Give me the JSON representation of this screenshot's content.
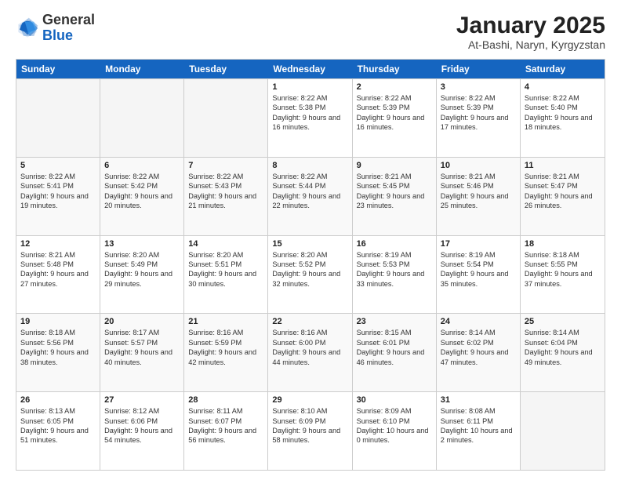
{
  "logo": {
    "general": "General",
    "blue": "Blue"
  },
  "title": "January 2025",
  "subtitle": "At-Bashi, Naryn, Kyrgyzstan",
  "days": [
    "Sunday",
    "Monday",
    "Tuesday",
    "Wednesday",
    "Thursday",
    "Friday",
    "Saturday"
  ],
  "weeks": [
    [
      {
        "day": "",
        "sunrise": "",
        "sunset": "",
        "daylight": "",
        "empty": true
      },
      {
        "day": "",
        "sunrise": "",
        "sunset": "",
        "daylight": "",
        "empty": true
      },
      {
        "day": "",
        "sunrise": "",
        "sunset": "",
        "daylight": "",
        "empty": true
      },
      {
        "day": "1",
        "sunrise": "Sunrise: 8:22 AM",
        "sunset": "Sunset: 5:38 PM",
        "daylight": "Daylight: 9 hours and 16 minutes."
      },
      {
        "day": "2",
        "sunrise": "Sunrise: 8:22 AM",
        "sunset": "Sunset: 5:39 PM",
        "daylight": "Daylight: 9 hours and 16 minutes."
      },
      {
        "day": "3",
        "sunrise": "Sunrise: 8:22 AM",
        "sunset": "Sunset: 5:39 PM",
        "daylight": "Daylight: 9 hours and 17 minutes."
      },
      {
        "day": "4",
        "sunrise": "Sunrise: 8:22 AM",
        "sunset": "Sunset: 5:40 PM",
        "daylight": "Daylight: 9 hours and 18 minutes."
      }
    ],
    [
      {
        "day": "5",
        "sunrise": "Sunrise: 8:22 AM",
        "sunset": "Sunset: 5:41 PM",
        "daylight": "Daylight: 9 hours and 19 minutes."
      },
      {
        "day": "6",
        "sunrise": "Sunrise: 8:22 AM",
        "sunset": "Sunset: 5:42 PM",
        "daylight": "Daylight: 9 hours and 20 minutes."
      },
      {
        "day": "7",
        "sunrise": "Sunrise: 8:22 AM",
        "sunset": "Sunset: 5:43 PM",
        "daylight": "Daylight: 9 hours and 21 minutes."
      },
      {
        "day": "8",
        "sunrise": "Sunrise: 8:22 AM",
        "sunset": "Sunset: 5:44 PM",
        "daylight": "Daylight: 9 hours and 22 minutes."
      },
      {
        "day": "9",
        "sunrise": "Sunrise: 8:21 AM",
        "sunset": "Sunset: 5:45 PM",
        "daylight": "Daylight: 9 hours and 23 minutes."
      },
      {
        "day": "10",
        "sunrise": "Sunrise: 8:21 AM",
        "sunset": "Sunset: 5:46 PM",
        "daylight": "Daylight: 9 hours and 25 minutes."
      },
      {
        "day": "11",
        "sunrise": "Sunrise: 8:21 AM",
        "sunset": "Sunset: 5:47 PM",
        "daylight": "Daylight: 9 hours and 26 minutes."
      }
    ],
    [
      {
        "day": "12",
        "sunrise": "Sunrise: 8:21 AM",
        "sunset": "Sunset: 5:48 PM",
        "daylight": "Daylight: 9 hours and 27 minutes."
      },
      {
        "day": "13",
        "sunrise": "Sunrise: 8:20 AM",
        "sunset": "Sunset: 5:49 PM",
        "daylight": "Daylight: 9 hours and 29 minutes."
      },
      {
        "day": "14",
        "sunrise": "Sunrise: 8:20 AM",
        "sunset": "Sunset: 5:51 PM",
        "daylight": "Daylight: 9 hours and 30 minutes."
      },
      {
        "day": "15",
        "sunrise": "Sunrise: 8:20 AM",
        "sunset": "Sunset: 5:52 PM",
        "daylight": "Daylight: 9 hours and 32 minutes."
      },
      {
        "day": "16",
        "sunrise": "Sunrise: 8:19 AM",
        "sunset": "Sunset: 5:53 PM",
        "daylight": "Daylight: 9 hours and 33 minutes."
      },
      {
        "day": "17",
        "sunrise": "Sunrise: 8:19 AM",
        "sunset": "Sunset: 5:54 PM",
        "daylight": "Daylight: 9 hours and 35 minutes."
      },
      {
        "day": "18",
        "sunrise": "Sunrise: 8:18 AM",
        "sunset": "Sunset: 5:55 PM",
        "daylight": "Daylight: 9 hours and 37 minutes."
      }
    ],
    [
      {
        "day": "19",
        "sunrise": "Sunrise: 8:18 AM",
        "sunset": "Sunset: 5:56 PM",
        "daylight": "Daylight: 9 hours and 38 minutes."
      },
      {
        "day": "20",
        "sunrise": "Sunrise: 8:17 AM",
        "sunset": "Sunset: 5:57 PM",
        "daylight": "Daylight: 9 hours and 40 minutes."
      },
      {
        "day": "21",
        "sunrise": "Sunrise: 8:16 AM",
        "sunset": "Sunset: 5:59 PM",
        "daylight": "Daylight: 9 hours and 42 minutes."
      },
      {
        "day": "22",
        "sunrise": "Sunrise: 8:16 AM",
        "sunset": "Sunset: 6:00 PM",
        "daylight": "Daylight: 9 hours and 44 minutes."
      },
      {
        "day": "23",
        "sunrise": "Sunrise: 8:15 AM",
        "sunset": "Sunset: 6:01 PM",
        "daylight": "Daylight: 9 hours and 46 minutes."
      },
      {
        "day": "24",
        "sunrise": "Sunrise: 8:14 AM",
        "sunset": "Sunset: 6:02 PM",
        "daylight": "Daylight: 9 hours and 47 minutes."
      },
      {
        "day": "25",
        "sunrise": "Sunrise: 8:14 AM",
        "sunset": "Sunset: 6:04 PM",
        "daylight": "Daylight: 9 hours and 49 minutes."
      }
    ],
    [
      {
        "day": "26",
        "sunrise": "Sunrise: 8:13 AM",
        "sunset": "Sunset: 6:05 PM",
        "daylight": "Daylight: 9 hours and 51 minutes."
      },
      {
        "day": "27",
        "sunrise": "Sunrise: 8:12 AM",
        "sunset": "Sunset: 6:06 PM",
        "daylight": "Daylight: 9 hours and 54 minutes."
      },
      {
        "day": "28",
        "sunrise": "Sunrise: 8:11 AM",
        "sunset": "Sunset: 6:07 PM",
        "daylight": "Daylight: 9 hours and 56 minutes."
      },
      {
        "day": "29",
        "sunrise": "Sunrise: 8:10 AM",
        "sunset": "Sunset: 6:09 PM",
        "daylight": "Daylight: 9 hours and 58 minutes."
      },
      {
        "day": "30",
        "sunrise": "Sunrise: 8:09 AM",
        "sunset": "Sunset: 6:10 PM",
        "daylight": "Daylight: 10 hours and 0 minutes."
      },
      {
        "day": "31",
        "sunrise": "Sunrise: 8:08 AM",
        "sunset": "Sunset: 6:11 PM",
        "daylight": "Daylight: 10 hours and 2 minutes."
      },
      {
        "day": "",
        "sunrise": "",
        "sunset": "",
        "daylight": "",
        "empty": true
      }
    ]
  ]
}
